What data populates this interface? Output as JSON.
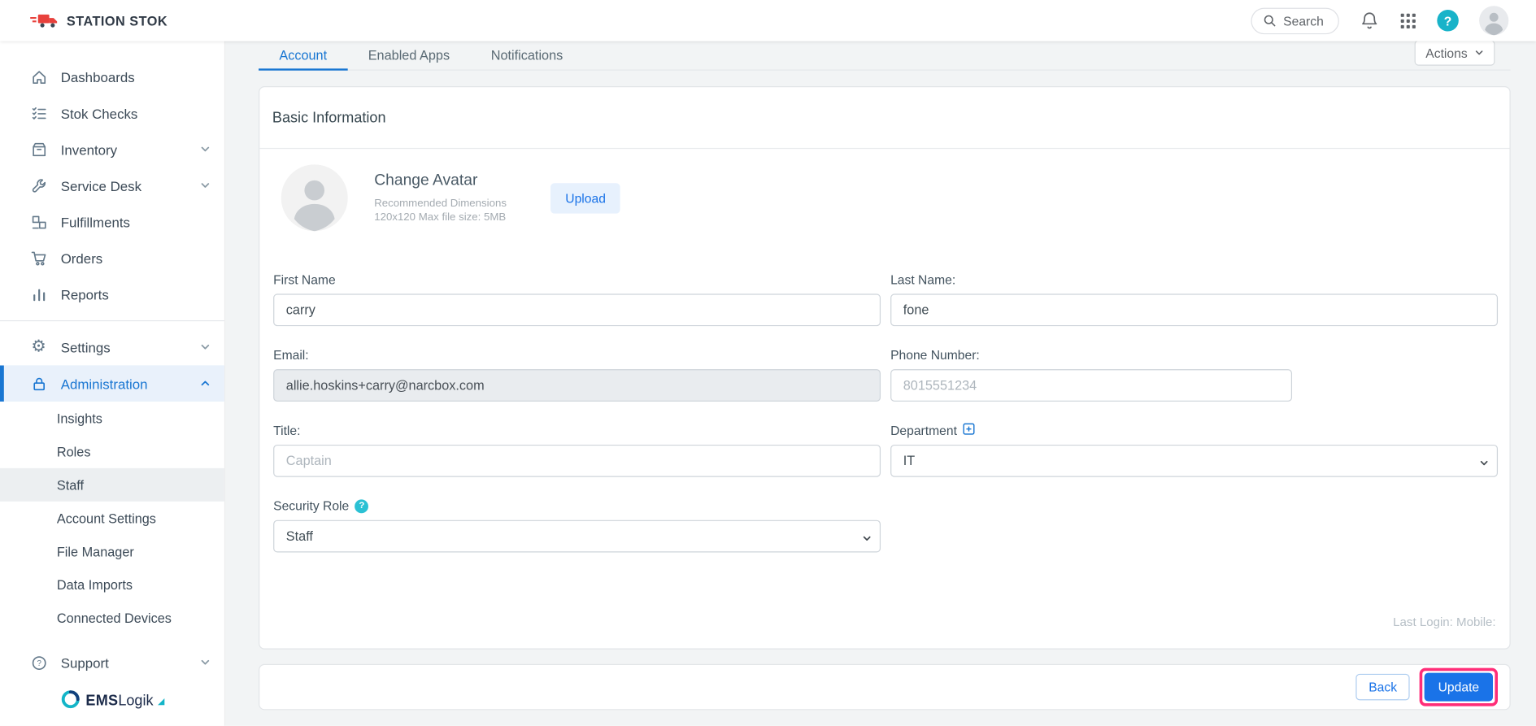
{
  "header": {
    "brand": "STATION STOK",
    "search_label": "Search"
  },
  "sidebar": {
    "items": [
      {
        "label": "Dashboards"
      },
      {
        "label": "Stok Checks"
      },
      {
        "label": "Inventory"
      },
      {
        "label": "Service Desk"
      },
      {
        "label": "Fulfillments"
      },
      {
        "label": "Orders"
      },
      {
        "label": "Reports"
      },
      {
        "label": "Settings"
      },
      {
        "label": "Administration"
      },
      {
        "label": "Support"
      }
    ],
    "admin_children": [
      "Insights",
      "Roles",
      "Staff",
      "Account Settings",
      "File Manager",
      "Data Imports",
      "Connected Devices"
    ],
    "logo": {
      "bold": "EMS",
      "rest": "Logik"
    }
  },
  "tabs": [
    "Account",
    "Enabled Apps",
    "Notifications"
  ],
  "actions_label": "Actions",
  "card": {
    "title": "Basic Information",
    "avatar": {
      "heading": "Change Avatar",
      "hint_line1": "Recommended Dimensions",
      "hint_line2": "120x120 Max file size: 5MB",
      "upload_label": "Upload"
    },
    "fields": {
      "first_name": {
        "label": "First Name",
        "value": "carry"
      },
      "last_name": {
        "label": "Last Name:",
        "value": "fone"
      },
      "email": {
        "label": "Email:",
        "value": "allie.hoskins+carry@narcbox.com"
      },
      "phone": {
        "label": "Phone Number:",
        "placeholder": "8015551234"
      },
      "title": {
        "label": "Title:",
        "placeholder": "Captain"
      },
      "department": {
        "label": "Department",
        "value": "IT"
      },
      "security_role": {
        "label": "Security Role",
        "value": "Staff"
      }
    },
    "last_login": "Last Login: Mobile:"
  },
  "footer": {
    "back": "Back",
    "update": "Update"
  },
  "colors": {
    "primary": "#1a73e8",
    "sidebar_active": "#1976d2",
    "highlight": "#ff2d78",
    "teal": "#18b3c9",
    "brand_red": "#e8413c"
  }
}
